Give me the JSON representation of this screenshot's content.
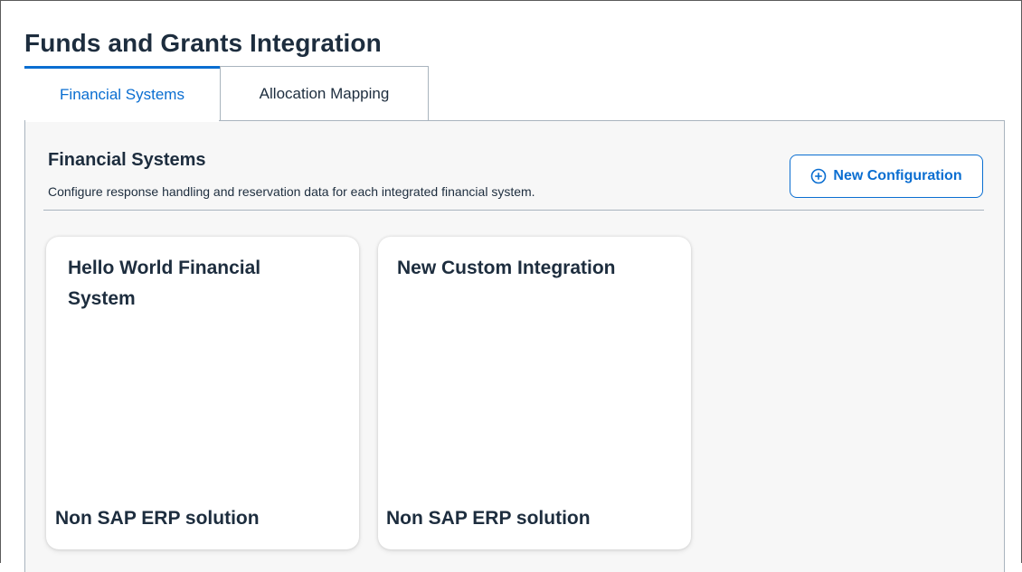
{
  "page": {
    "title": "Funds and Grants Integration"
  },
  "tabs": [
    {
      "label": "Financial Systems",
      "active": true
    },
    {
      "label": "Allocation Mapping",
      "active": false
    }
  ],
  "section": {
    "title": "Financial Systems",
    "description": "Configure response handling and reservation data for each integrated financial system.",
    "new_button_label": "New Configuration",
    "new_button_icon": "plus-circle-icon"
  },
  "cards": [
    {
      "title": "Hello World Financial System",
      "footer": "Non SAP ERP solution"
    },
    {
      "title": "New Custom Integration",
      "footer": "Non SAP ERP solution"
    }
  ],
  "colors": {
    "accent": "#0a6ed1",
    "text": "#1d2d3e",
    "panel_bg": "#f7f7f7",
    "border": "#a9b4be"
  }
}
